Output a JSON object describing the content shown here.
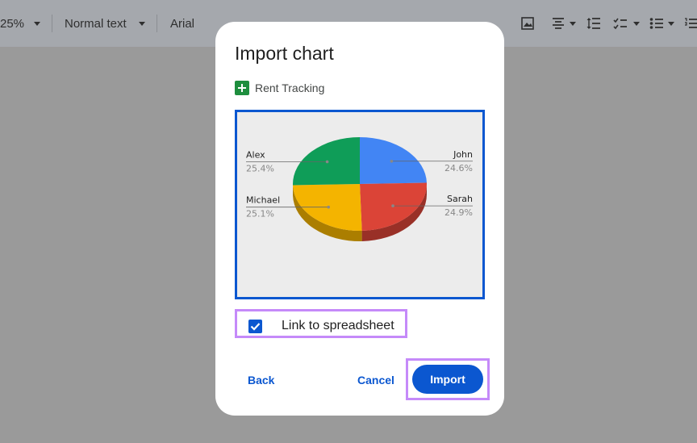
{
  "toolbar": {
    "zoom": "25%",
    "style": "Normal text",
    "font": "Arial"
  },
  "dialog": {
    "title": "Import chart",
    "sheet_name": "Rent Tracking",
    "link_label": "Link to spreadsheet",
    "link_checked": true,
    "back_label": "Back",
    "cancel_label": "Cancel",
    "import_label": "Import"
  },
  "chart_data": {
    "type": "pie",
    "slices": [
      {
        "label": "John",
        "percent": 24.6,
        "percent_label": "24.6%",
        "color": "#4285f4"
      },
      {
        "label": "Sarah",
        "percent": 24.9,
        "percent_label": "24.9%",
        "color": "#db4437"
      },
      {
        "label": "Michael",
        "percent": 25.1,
        "percent_label": "25.1%",
        "color": "#f4b400"
      },
      {
        "label": "Alex",
        "percent": 25.4,
        "percent_label": "25.4%",
        "color": "#0f9d58"
      }
    ],
    "three_d": true
  }
}
